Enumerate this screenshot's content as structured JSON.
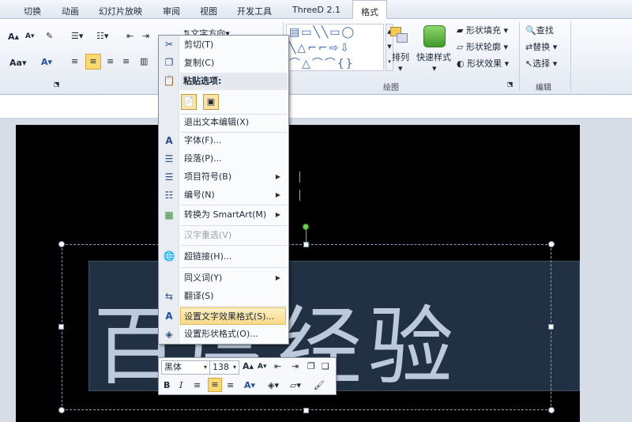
{
  "tabs": [
    "切换",
    "动画",
    "幻灯片放映",
    "审阅",
    "视图",
    "开发工具",
    "ThreeD 2.1",
    "格式"
  ],
  "ribbon": {
    "font_size_up": "A",
    "font_size_down": "A",
    "font_color": "A",
    "case_button": "Aa",
    "text_direction": "文字方向",
    "arrange": "排列",
    "quick_styles": "快速样式",
    "shape_fill": "形状填充",
    "shape_outline": "形状轮廓",
    "shape_effects": "形状效果",
    "find": "查找",
    "replace": "替换",
    "select": "选择",
    "group_drawing": "绘图",
    "group_editing": "编辑"
  },
  "slide": {
    "text": "百度经验"
  },
  "context_menu": {
    "items": [
      {
        "label": "剪切(T)",
        "icon": "scissors-icon"
      },
      {
        "label": "复制(C)",
        "icon": "copy-icon"
      },
      {
        "label": "粘贴选项:",
        "icon": "clipboard-icon"
      },
      {
        "label": "退出文本编辑(X)"
      },
      {
        "label": "字体(F)...",
        "icon": "font-icon"
      },
      {
        "label": "段落(P)...",
        "icon": "paragraph-icon"
      },
      {
        "label": "项目符号(B)",
        "icon": "bullets-icon"
      },
      {
        "label": "编号(N)",
        "icon": "numbering-icon"
      },
      {
        "label": "转换为 SmartArt(M)",
        "icon": "smartart-icon"
      },
      {
        "label": "汉字重选(V)"
      },
      {
        "label": "超链接(H)...",
        "icon": "hyperlink-icon"
      },
      {
        "label": "同义词(Y)"
      },
      {
        "label": "翻译(S)",
        "icon": "translate-icon"
      },
      {
        "label": "设置文字效果格式(S)...",
        "icon": "text-effect-icon"
      },
      {
        "label": "设置形状格式(O)...",
        "icon": "shape-format-icon"
      }
    ]
  },
  "mini_toolbar": {
    "font": "黑体",
    "size": "138",
    "bold": "B",
    "italic": "I",
    "grow": "A",
    "shrink": "A",
    "color": "A"
  }
}
